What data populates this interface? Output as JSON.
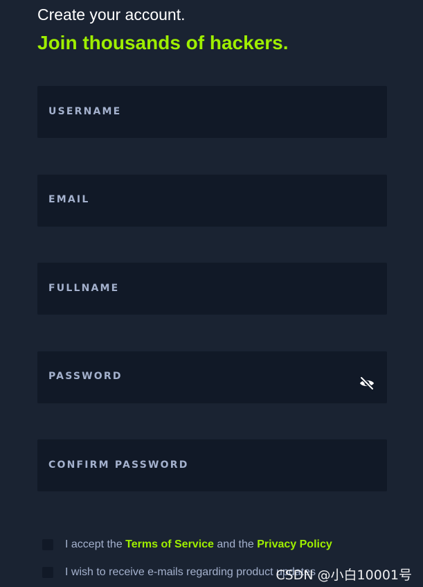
{
  "header": {
    "title": "Create your account.",
    "subtitle": "Join thousands of hackers."
  },
  "form": {
    "fields": [
      {
        "label": "USERNAME",
        "value": ""
      },
      {
        "label": "EMAIL",
        "value": ""
      },
      {
        "label": "FULLNAME",
        "value": ""
      },
      {
        "label": "PASSWORD",
        "value": "",
        "icon": "eye-slash-icon"
      },
      {
        "label": "CONFIRM PASSWORD",
        "value": ""
      }
    ]
  },
  "checkboxes": {
    "terms": {
      "checked": false,
      "prefix": "I accept the",
      "tos_link": "Terms of Service",
      "middle": "and the",
      "privacy_link": "Privacy Policy"
    },
    "emails": {
      "checked": false,
      "text": "I wish to receive e-mails regarding product updates"
    }
  },
  "watermark": "CSDN @小白10001号",
  "colors": {
    "background": "#1a2332",
    "field_background": "#111927",
    "accent": "#9fef00",
    "label": "#a4b1cd",
    "title": "#ffffff"
  }
}
